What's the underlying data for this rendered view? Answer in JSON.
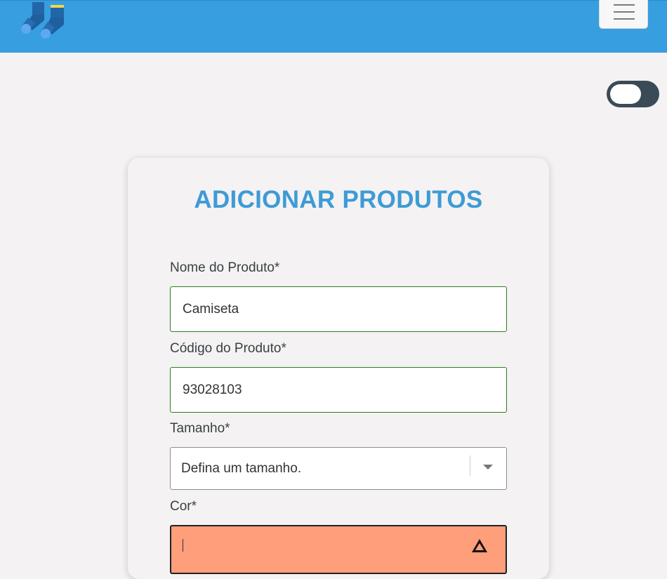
{
  "header": {
    "logo_icon": "socks-logo-icon",
    "menu_icon": "hamburger-menu-icon",
    "background_color": "#379ee0"
  },
  "theme_toggle": {
    "icon": "toggle-switch"
  },
  "form": {
    "title": "ADICIONAR PRODUTOS",
    "fields": {
      "name": {
        "label": "Nome do Produto*",
        "value": "Camiseta"
      },
      "code": {
        "label": "Código do Produto*",
        "value": "93028103"
      },
      "size": {
        "label": "Tamanho*",
        "selected": "Defina um tamanho."
      },
      "color": {
        "label": "Cor*",
        "value": ""
      }
    },
    "colors": {
      "title": "#3e9bd6",
      "valid_border": "#2e7d1f",
      "error_background": "#ff9e7b"
    }
  }
}
